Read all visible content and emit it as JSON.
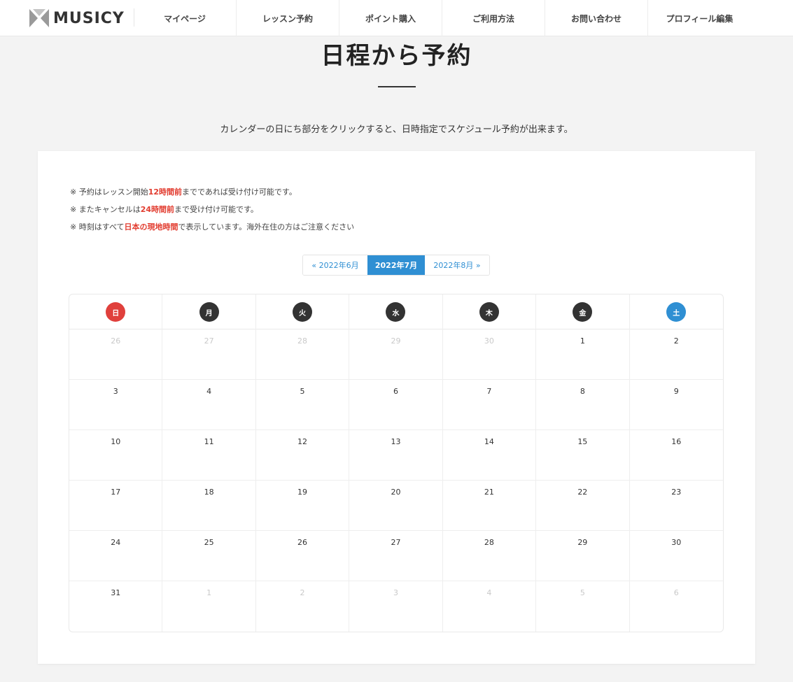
{
  "header": {
    "logo_text": "MUSICY",
    "nav": [
      "マイページ",
      "レッスン予約",
      "ポイント購入",
      "ご利用方法",
      "お問い合わせ",
      "プロフィール編集"
    ]
  },
  "page": {
    "title": "日程から予約",
    "intro": "カレンダーの日にち部分をクリックすると、日時指定でスケジュール予約が出来ます。"
  },
  "notes": [
    {
      "prefix": "※ 予約はレッスン開始",
      "highlight": "12時間前",
      "suffix": "までであれば受け付け可能です。"
    },
    {
      "prefix": "※ またキャンセルは",
      "highlight": "24時間前",
      "suffix": "まで受け付け可能です。"
    },
    {
      "prefix": "※ 時刻はすべて",
      "highlight": "日本の現地時間",
      "suffix": "で表示しています。海外在住の方はご注意ください"
    }
  ],
  "month_nav": {
    "prev": "« 2022年6月",
    "current": "2022年7月",
    "next": "2022年8月 »"
  },
  "calendar": {
    "weekdays": [
      "日",
      "月",
      "火",
      "水",
      "木",
      "金",
      "土"
    ],
    "weeks": [
      [
        {
          "d": "26",
          "m": true
        },
        {
          "d": "27",
          "m": true
        },
        {
          "d": "28",
          "m": true
        },
        {
          "d": "29",
          "m": true
        },
        {
          "d": "30",
          "m": true
        },
        {
          "d": "1",
          "m": false
        },
        {
          "d": "2",
          "m": false
        }
      ],
      [
        {
          "d": "3",
          "m": false
        },
        {
          "d": "4",
          "m": false
        },
        {
          "d": "5",
          "m": false
        },
        {
          "d": "6",
          "m": false
        },
        {
          "d": "7",
          "m": false
        },
        {
          "d": "8",
          "m": false
        },
        {
          "d": "9",
          "m": false
        }
      ],
      [
        {
          "d": "10",
          "m": false
        },
        {
          "d": "11",
          "m": false
        },
        {
          "d": "12",
          "m": false
        },
        {
          "d": "13",
          "m": false
        },
        {
          "d": "14",
          "m": false
        },
        {
          "d": "15",
          "m": false
        },
        {
          "d": "16",
          "m": false
        }
      ],
      [
        {
          "d": "17",
          "m": false
        },
        {
          "d": "18",
          "m": false
        },
        {
          "d": "19",
          "m": false
        },
        {
          "d": "20",
          "m": false
        },
        {
          "d": "21",
          "m": false
        },
        {
          "d": "22",
          "m": false
        },
        {
          "d": "23",
          "m": false
        }
      ],
      [
        {
          "d": "24",
          "m": false
        },
        {
          "d": "25",
          "m": false
        },
        {
          "d": "26",
          "m": false
        },
        {
          "d": "27",
          "m": false
        },
        {
          "d": "28",
          "m": false
        },
        {
          "d": "29",
          "m": false
        },
        {
          "d": "30",
          "m": false
        }
      ],
      [
        {
          "d": "31",
          "m": false
        },
        {
          "d": "1",
          "m": true
        },
        {
          "d": "2",
          "m": true
        },
        {
          "d": "3",
          "m": true
        },
        {
          "d": "4",
          "m": true
        },
        {
          "d": "5",
          "m": true
        },
        {
          "d": "6",
          "m": true
        }
      ]
    ]
  },
  "colors": {
    "accent": "#2f8fd3",
    "highlight": "#e23c2f",
    "sunday": "#e0403c",
    "saturday": "#2f8fd3"
  }
}
